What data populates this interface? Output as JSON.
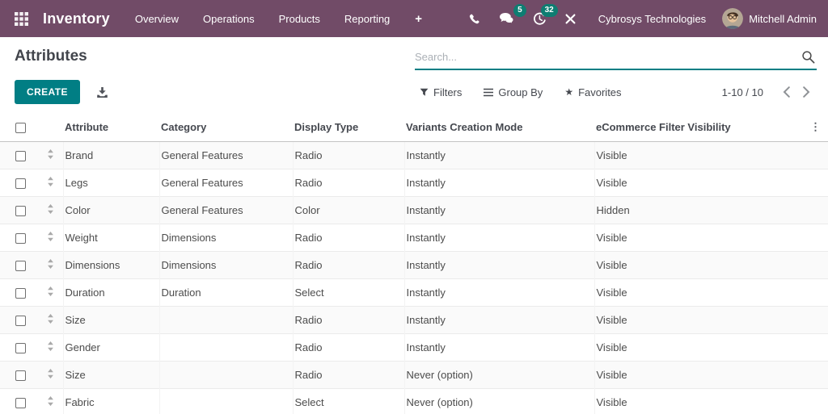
{
  "colors": {
    "navbar": "#714B67",
    "accent": "#017E84",
    "badge": "#0E7D72"
  },
  "navbar": {
    "app_name": "Inventory",
    "menu_items": [
      "Overview",
      "Operations",
      "Products",
      "Reporting"
    ],
    "plus_label": "+",
    "messages_badge": "5",
    "activities_badge": "32",
    "company_name": "Cybrosys Technologies",
    "user_name": "Mitchell Admin"
  },
  "control_panel": {
    "title": "Attributes",
    "create_button": "CREATE",
    "search_placeholder": "Search...",
    "filters": "Filters",
    "group_by": "Group By",
    "favorites": "Favorites",
    "pager_value": "1-10 / 10"
  },
  "table": {
    "columns": [
      "Attribute",
      "Category",
      "Display Type",
      "Variants Creation Mode",
      "eCommerce Filter Visibility"
    ],
    "rows": [
      {
        "attribute": "Brand",
        "category": "General Features",
        "display_type": "Radio",
        "variants_creation_mode": "Instantly",
        "ecommerce_filter_visibility": "Visible"
      },
      {
        "attribute": "Legs",
        "category": "General Features",
        "display_type": "Radio",
        "variants_creation_mode": "Instantly",
        "ecommerce_filter_visibility": "Visible"
      },
      {
        "attribute": "Color",
        "category": "General Features",
        "display_type": "Color",
        "variants_creation_mode": "Instantly",
        "ecommerce_filter_visibility": "Hidden"
      },
      {
        "attribute": "Weight",
        "category": "Dimensions",
        "display_type": "Radio",
        "variants_creation_mode": "Instantly",
        "ecommerce_filter_visibility": "Visible"
      },
      {
        "attribute": "Dimensions",
        "category": "Dimensions",
        "display_type": "Radio",
        "variants_creation_mode": "Instantly",
        "ecommerce_filter_visibility": "Visible"
      },
      {
        "attribute": "Duration",
        "category": "Duration",
        "display_type": "Select",
        "variants_creation_mode": "Instantly",
        "ecommerce_filter_visibility": "Visible"
      },
      {
        "attribute": "Size",
        "category": "",
        "display_type": "Radio",
        "variants_creation_mode": "Instantly",
        "ecommerce_filter_visibility": "Visible"
      },
      {
        "attribute": "Gender",
        "category": "",
        "display_type": "Radio",
        "variants_creation_mode": "Instantly",
        "ecommerce_filter_visibility": "Visible"
      },
      {
        "attribute": "Size",
        "category": "",
        "display_type": "Radio",
        "variants_creation_mode": "Never (option)",
        "ecommerce_filter_visibility": "Visible"
      },
      {
        "attribute": "Fabric",
        "category": "",
        "display_type": "Select",
        "variants_creation_mode": "Never (option)",
        "ecommerce_filter_visibility": "Visible"
      }
    ]
  }
}
